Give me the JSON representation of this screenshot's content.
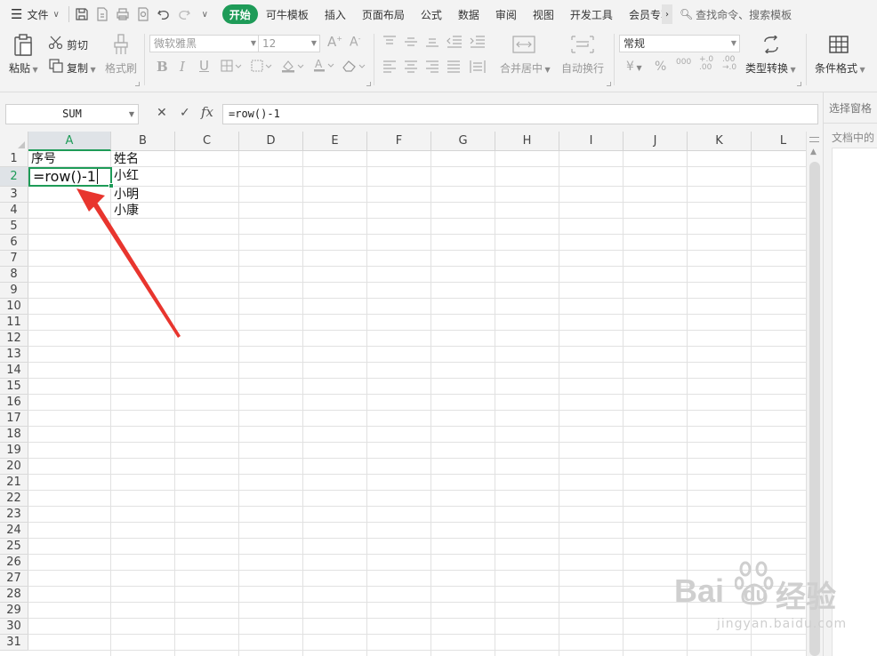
{
  "menubar": {
    "menu_label": "文件",
    "tabs": [
      "开始",
      "可牛模板",
      "插入",
      "页面布局",
      "公式",
      "数据",
      "审阅",
      "视图",
      "开发工具",
      "会员专享"
    ],
    "search": "查找命令、搜索模板"
  },
  "ribbon": {
    "paste": "粘贴",
    "cut": "剪切",
    "copy": "复制",
    "format_painter": "格式刷",
    "font_name": "微软雅黑",
    "font_size": "12",
    "merge_center": "合并居中",
    "wrap_text": "自动换行",
    "number_format": "常规",
    "currency": "¥",
    "percent": "%",
    "thousands": "000",
    "inc_decimal": "+.0 .00",
    "dec_decimal": ".00 →.0",
    "type_convert": "类型转换",
    "conditional_format": "条件格式"
  },
  "formula_bar": {
    "name_box": "SUM",
    "cancel": "✕",
    "confirm": "✓",
    "fx": "fx",
    "formula": "=row()-1"
  },
  "right_panel": {
    "title": "选择窗格",
    "subtitle": "文档中的"
  },
  "sheet": {
    "columns": [
      "A",
      "B",
      "C",
      "D",
      "E",
      "F",
      "G",
      "H",
      "I",
      "J",
      "K",
      "L"
    ],
    "rows": [
      "1",
      "2",
      "3",
      "4",
      "5",
      "6",
      "7",
      "8",
      "9",
      "10",
      "11",
      "12",
      "13",
      "14",
      "15",
      "16",
      "17",
      "18",
      "19",
      "20",
      "21",
      "22",
      "23",
      "24",
      "25",
      "26",
      "27",
      "28",
      "29",
      "30",
      "31"
    ],
    "selected_column": "A",
    "selected_row": "2",
    "cells": {
      "A1": "序号",
      "B1": "姓名",
      "A2_editing": "=row()-1",
      "B2": "小红",
      "B3": "小明",
      "B4": "小康"
    }
  },
  "watermark": {
    "brand": "Bai",
    "brand_suffix": "du",
    "product": "经验",
    "url": "jingyan.baidu.com"
  },
  "colors": {
    "accent": "#1e9b58",
    "annotation_arrow": "#e8352e"
  }
}
